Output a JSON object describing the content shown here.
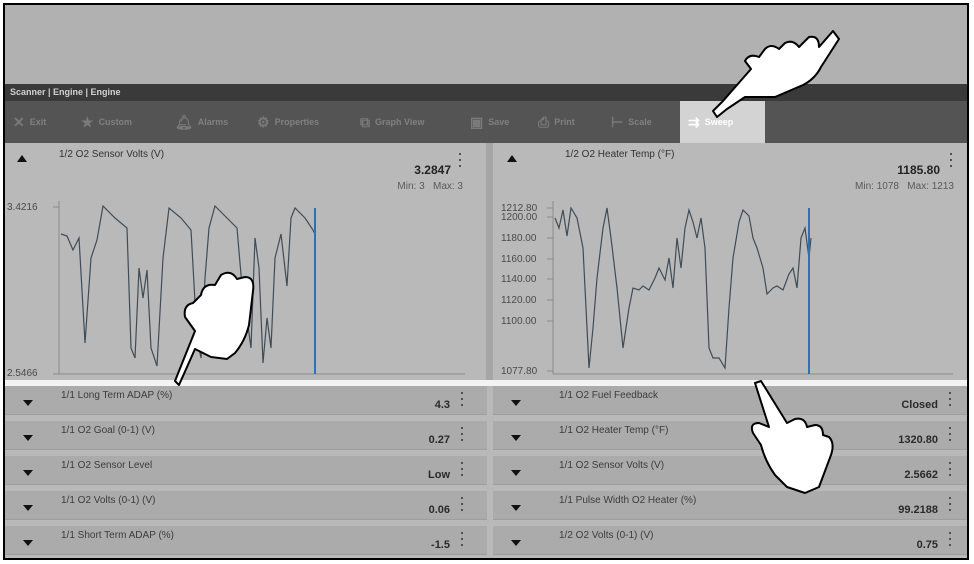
{
  "app": {
    "breadcrumb": "Scanner | Engine | Engine"
  },
  "toolbar": {
    "exit": "Exit",
    "custom": "Custom",
    "alarms": "Alarms",
    "properties": "Properties",
    "graph_view": "Graph View",
    "save": "Save",
    "print": "Print",
    "scale": "Scale",
    "sweep": "Sweep"
  },
  "colors": {
    "graph_line": "#3f4c58",
    "sweep_line": "#2e6fb5",
    "active_tab": "#d3d3d3"
  },
  "graphs": {
    "left": {
      "title": "1/2 O2 Sensor Volts (V)",
      "value": "3.2847",
      "min": "Min: 3",
      "max": "Max: 3",
      "y_top_label": "3.4216",
      "y_bottom_label": "2.5466"
    },
    "right": {
      "title": "1/2 O2 Heater Temp (°F)",
      "value": "1185.80",
      "min": "Min: 1078",
      "max": "Max: 1213",
      "y_labels": [
        "1212.80",
        "1200.00",
        "1180.00",
        "1160.00",
        "1140.00",
        "1120.00",
        "1100.00",
        "1077.80"
      ]
    }
  },
  "rows": {
    "left": [
      {
        "label": "1/1 Long Term ADAP (%)",
        "value": "4.3"
      },
      {
        "label": "1/1 O2 Goal (0-1) (V)",
        "value": "0.27"
      },
      {
        "label": "1/1 O2 Sensor Level",
        "value": "Low"
      },
      {
        "label": "1/1 O2 Volts (0-1) (V)",
        "value": "0.06"
      },
      {
        "label": "1/1 Short Term ADAP (%)",
        "value": "-1.5"
      }
    ],
    "right": [
      {
        "label": "1/1 O2 Fuel Feedback",
        "value": "Closed"
      },
      {
        "label": "1/1 O2 Heater Temp (°F)",
        "value": "1320.80"
      },
      {
        "label": "1/1 O2 Sensor Volts (V)",
        "value": "2.5662"
      },
      {
        "label": "1/1 Pulse Width O2 Heater (%)",
        "value": "99.2188"
      },
      {
        "label": "1/2 O2 Volts (0-1) (V)",
        "value": "0.75"
      }
    ]
  }
}
